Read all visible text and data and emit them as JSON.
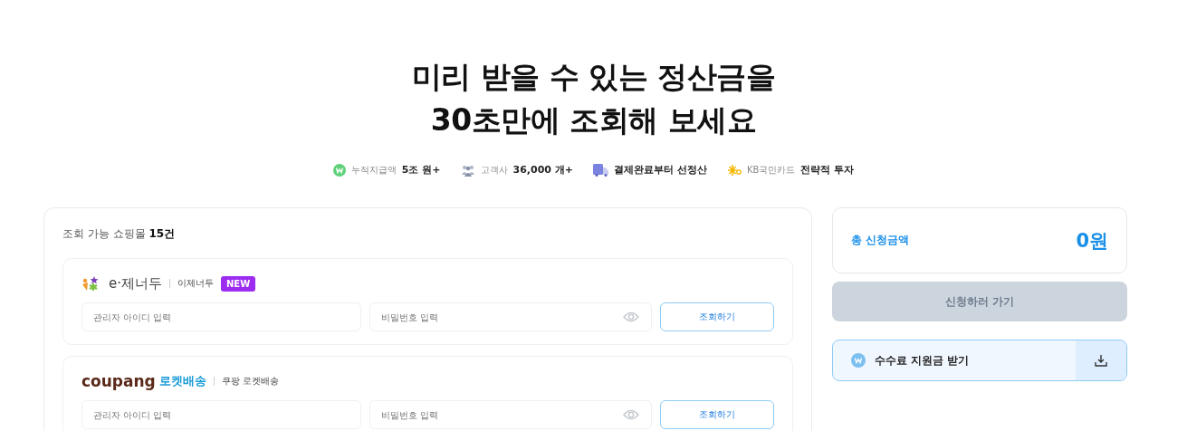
{
  "headline": [
    "미리 받을 수 있는 정산금을",
    "30초만에 조회해 보세요"
  ],
  "stats": [
    {
      "kind": "won",
      "label": "누적지급액",
      "value": "5조 원+"
    },
    {
      "kind": "people",
      "label": "고객사",
      "value": "36,000 개+"
    },
    {
      "kind": "truck",
      "value": "결제완료부터 선정산"
    },
    {
      "kind": "kb",
      "label": "KB국민카드",
      "value": "전략적 투자"
    }
  ],
  "mall_list": {
    "caption": "조회 가능 쇼핑몰 ",
    "count": "15건",
    "malls": [
      {
        "kind": "ezenerdu",
        "logo_text": "e·제너두",
        "name": "이제너두",
        "badge": "NEW",
        "id_placeholder": "관리자 아이디 입력",
        "pw_placeholder": "비밀번호 입력",
        "button": "조회하기"
      },
      {
        "kind": "coupang",
        "logo_text": "coupang",
        "logo_sub": "로켓배송",
        "name": "쿠팡 로켓배송",
        "id_placeholder": "관리자 아이디 입력",
        "pw_placeholder": "비밀번호 입력",
        "button": "조회하기"
      }
    ]
  },
  "summary": {
    "label": "총 신청금액",
    "amount": "0원"
  },
  "apply_button": {
    "label": "신청하러 가기",
    "disabled": true
  },
  "fee_support": {
    "label": "수수료 지원금 받기"
  }
}
